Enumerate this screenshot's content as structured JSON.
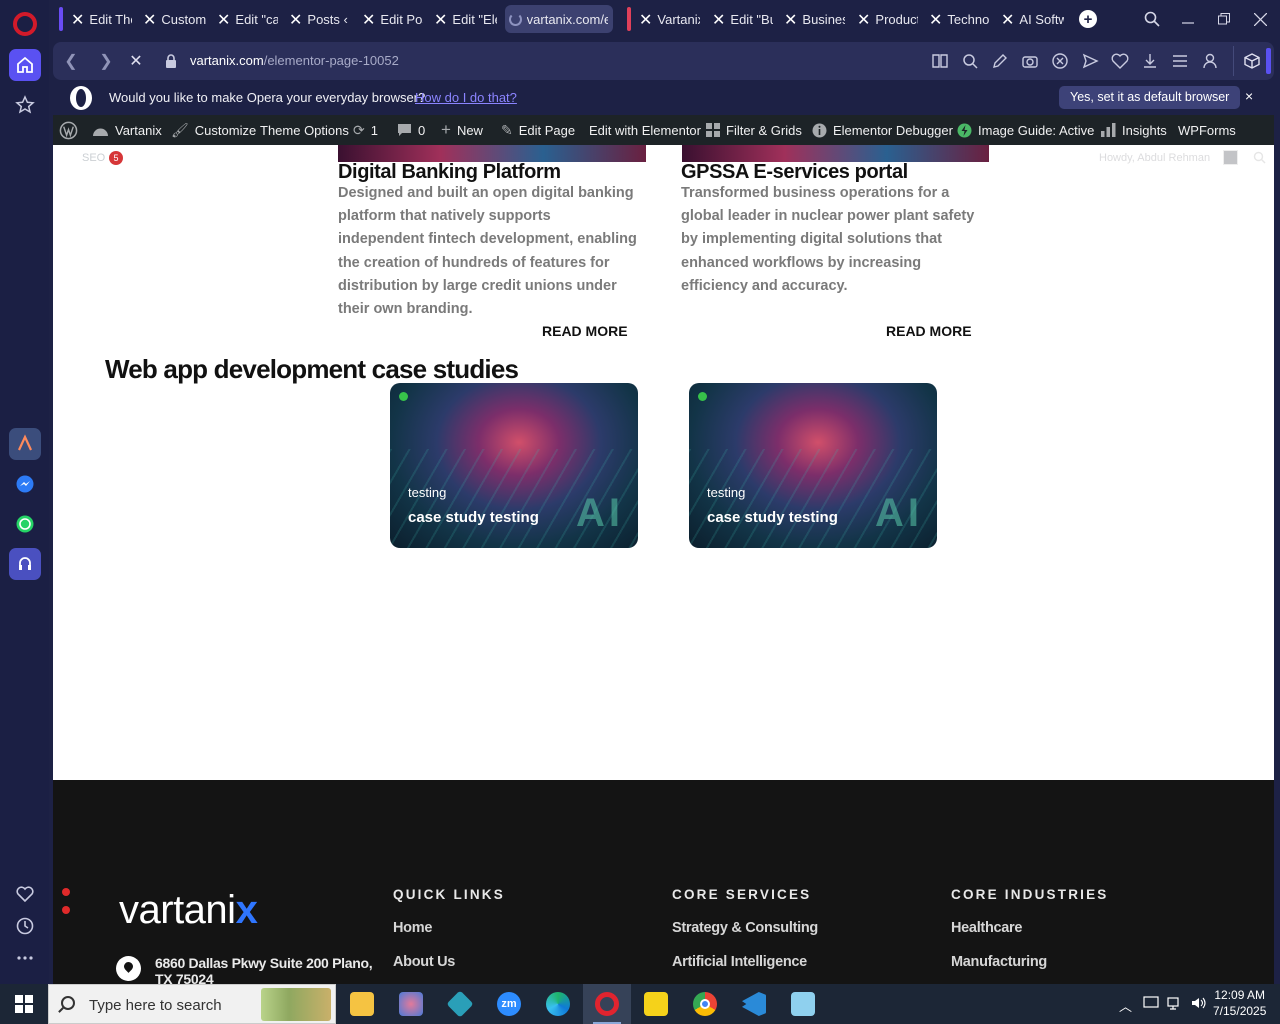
{
  "browser": {
    "tabs": [
      {
        "title": "Edit The"
      },
      {
        "title": "Customi"
      },
      {
        "title": "Edit \"cas"
      },
      {
        "title": "Posts ‹ V"
      },
      {
        "title": "Edit Pos"
      },
      {
        "title": "Edit \"Ele"
      },
      {
        "title": "vartanix.com/e"
      },
      {
        "title": "Vartanix"
      },
      {
        "title": "Edit \"Bu"
      },
      {
        "title": "Busines"
      },
      {
        "title": "Product"
      },
      {
        "title": "Technol"
      },
      {
        "title": "AI Softw"
      }
    ],
    "url_domain": "vartanix.com",
    "url_path": "/elementor-page-10052",
    "colors": {
      "accent": "#5a51f2",
      "opera_red": "#d21a2a",
      "tab_group_purple": "#6a4cf5",
      "tab_group_red": "#e0405a"
    }
  },
  "default_bar": {
    "message": "Would you like to make Opera your everyday browser?",
    "link": "How do I do that?",
    "button": "Yes, set it as default browser",
    "close": "×"
  },
  "wp_admin": {
    "site": "Vartanix",
    "customize": "Customize",
    "theme_options": "Theme Options",
    "updates": "1",
    "comments": "0",
    "new": "New",
    "edit_page": "Edit Page",
    "edit_elementor": "Edit with Elementor",
    "filter_grids": "Filter & Grids",
    "debugger": "Elementor Debugger",
    "image_guide": "Image Guide: Active",
    "insights": "Insights",
    "wpforms": "WPForms",
    "seo": "SEO",
    "seo_count": "5",
    "howdy": "Howdy, Abdul Rehman"
  },
  "content": {
    "cards": [
      {
        "title": "Digital Banking Platform",
        "desc": "Designed and built an open digital banking platform that natively supports independent fintech development, enabling the creation of hundreds of features for distribution by large credit unions under their own branding.",
        "link": "READ MORE"
      },
      {
        "title": "GPSSA E-services portal",
        "desc": "Transformed business operations for a global leader in nuclear power plant safety by implementing digital solutions that enhanced workflows by increasing efficiency and accuracy.",
        "link": "READ MORE"
      }
    ],
    "section_heading": "Web app development case studies",
    "case_studies": [
      {
        "category": "testing",
        "title": "case study testing",
        "art_text": "AI"
      },
      {
        "category": "testing",
        "title": "case study testing",
        "art_text": "AI"
      }
    ]
  },
  "footer": {
    "logo_main": "vartani",
    "logo_x": "x",
    "address": "6860 Dallas Pkwy Suite 200 Plano, TX 75024",
    "quick_links_heading": "QUICK LINKS",
    "quick_links": [
      "Home",
      "About Us"
    ],
    "services_heading": "CORE SERVICES",
    "services": [
      "Strategy & Consulting",
      "Artificial Intelligence"
    ],
    "industries_heading": "CORE INDUSTRIES",
    "industries": [
      "Healthcare",
      "Manufacturing"
    ]
  },
  "taskbar": {
    "search_placeholder": "Type here to search",
    "time": "12:09 AM",
    "date": "7/15/2025"
  }
}
